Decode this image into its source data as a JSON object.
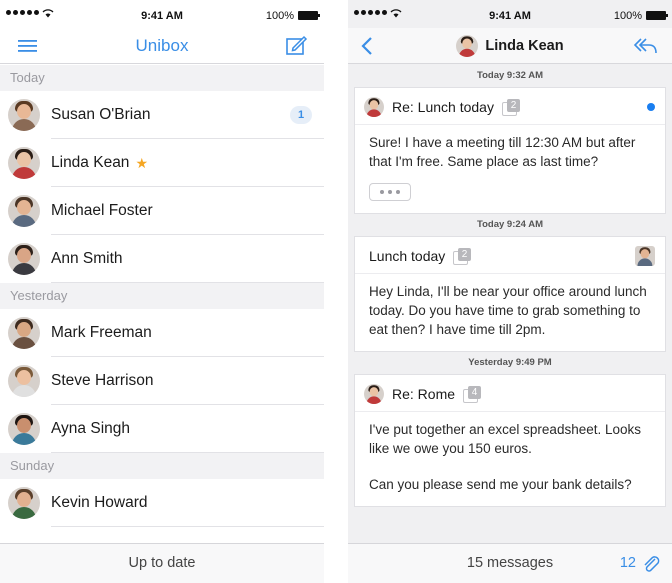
{
  "status": {
    "time": "9:41 AM",
    "battery": "100%"
  },
  "left": {
    "title": "Unibox",
    "sections": [
      {
        "label": "Today",
        "contacts": [
          {
            "name": "Susan O'Brian",
            "badge": "1",
            "skin": "#e8b896",
            "hair": "#5a3a22",
            "shirt": "#8a6a55"
          },
          {
            "name": "Linda Kean",
            "star": true,
            "skin": "#eac3a5",
            "hair": "#2a1d16",
            "shirt": "#c03a3a"
          },
          {
            "name": "Michael Foster",
            "skin": "#e3b493",
            "hair": "#4a3526",
            "shirt": "#5a6a80"
          },
          {
            "name": "Ann Smith",
            "skin": "#d9a586",
            "hair": "#2e211a",
            "shirt": "#3a3a40"
          }
        ]
      },
      {
        "label": "Yesterday",
        "contacts": [
          {
            "name": "Mark Freeman",
            "skin": "#d9a783",
            "hair": "#3d2a1e",
            "shirt": "#6a5040"
          },
          {
            "name": "Steve Harrison",
            "skin": "#ecc0a0",
            "hair": "#7a5a3a",
            "shirt": "#e0e0e0"
          },
          {
            "name": "Ayna Singh",
            "skin": "#c98f6e",
            "hair": "#1f1612",
            "shirt": "#3a7a9a"
          }
        ]
      },
      {
        "label": "Sunday",
        "contacts": [
          {
            "name": "Kevin Howard",
            "skin": "#e2b08f",
            "hair": "#5a3f2a",
            "shirt": "#3a6a40"
          }
        ]
      }
    ],
    "footer": "Up to date",
    "icons": {
      "menu": "menu-icon",
      "compose": "compose-icon"
    }
  },
  "right": {
    "contact": "Linda Kean",
    "messages": [
      {
        "time": "Today 9:32 AM",
        "subject": "Re: Lunch today",
        "count": "2",
        "unread": true,
        "avatar": "linda",
        "body": "Sure! I have a meeting till 12:30 AM but after that I'm free. Same place as last time?",
        "more": true
      },
      {
        "time": "Today 9:24 AM",
        "subject": "Lunch today",
        "count": "2",
        "unread": false,
        "avatar": "michael-right",
        "body": "Hey Linda, I'll be near your office around lunch today. Do you have time to grab something to eat then? I have time till 2pm."
      },
      {
        "time": "Yesterday 9:49 PM",
        "subject": "Re: Rome",
        "count": "4",
        "unread": false,
        "avatar": "linda",
        "body": "I've put together an excel spreadsheet. Looks like we owe you 150 euros.",
        "body2": "Can you please send me your bank details?"
      }
    ],
    "footer": {
      "messages": "15 messages",
      "attachments": "12"
    }
  }
}
